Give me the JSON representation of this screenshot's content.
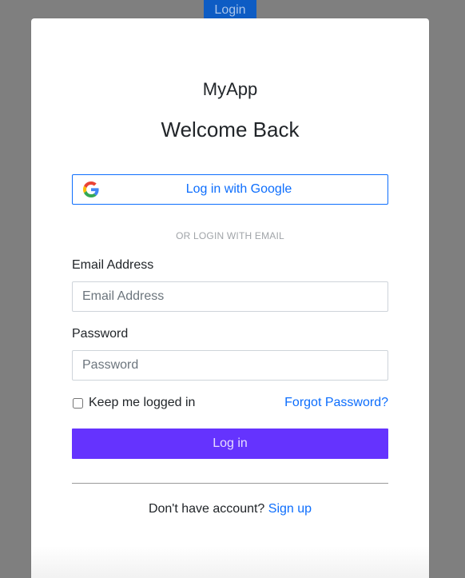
{
  "header": {
    "login_label": "Login"
  },
  "modal": {
    "app_name": "MyApp",
    "title": "Welcome Back",
    "google_button_label": "Log in with Google",
    "divider_text": "OR LOGIN WITH EMAIL",
    "email": {
      "label": "Email Address",
      "placeholder": "Email Address",
      "value": ""
    },
    "password": {
      "label": "Password",
      "placeholder": "Password",
      "value": ""
    },
    "remember_label": "Keep me logged in",
    "remember_checked": false,
    "forgot_label": "Forgot Password?",
    "login_button_label": "Log in",
    "signup_prompt": "Don't have account?",
    "signup_label": "Sign up"
  },
  "colors": {
    "backdrop": "#7f7f7f",
    "link_blue": "#0d6efd",
    "primary_purple": "#6533fe",
    "header_button": "#0d5cc4"
  },
  "icons": {
    "google": "google-icon"
  }
}
